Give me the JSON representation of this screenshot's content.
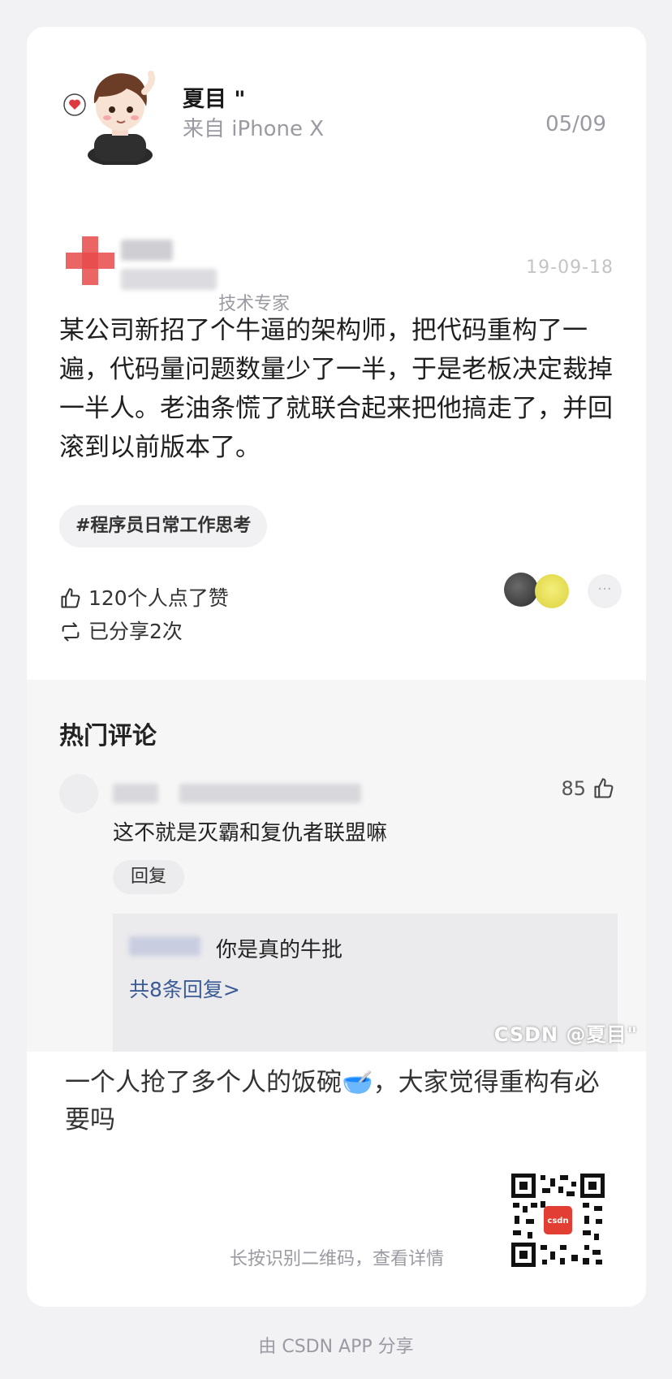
{
  "author": {
    "name": "夏目 \"",
    "source": "来自 iPhone X",
    "date": "05/09"
  },
  "original_post": {
    "date": "19-09-18",
    "role": "技术专家",
    "text": "某公司新招了个牛逼的架构师，把代码重构了一遍，代码量问题数量少了一半，于是老板决定裁掉一半人。老油条慌了就联合起来把他搞走了，并回滚到以前版本了。",
    "hashtag": "#程序员日常工作思考",
    "likes_text": "120个人点了赞",
    "shares_text": "已分享2次",
    "more_label": "···"
  },
  "hot_comments": {
    "title": "热门评论",
    "comment": {
      "text": "这不就是灭霸和复仇者联盟嘛",
      "likes": "85",
      "reply_label": "回复",
      "sub_reply_text": "你是真的牛批",
      "more_replies": "共8条回复>"
    }
  },
  "watermark": "CSDN @夏目\"",
  "caption": "一个人抢了多个人的饭碗🥣，大家觉得重构有必要吗",
  "qr": {
    "hint": "长按识别二维码，查看详情",
    "badge": "csdn"
  },
  "footer": "由 CSDN APP 分享",
  "colors": {
    "page_bg": "#f2f2f5",
    "card_bg": "#ffffff",
    "muted_text": "#9a9aa2",
    "link_blue": "#3b5b96",
    "csdn_red": "#e33e33"
  }
}
